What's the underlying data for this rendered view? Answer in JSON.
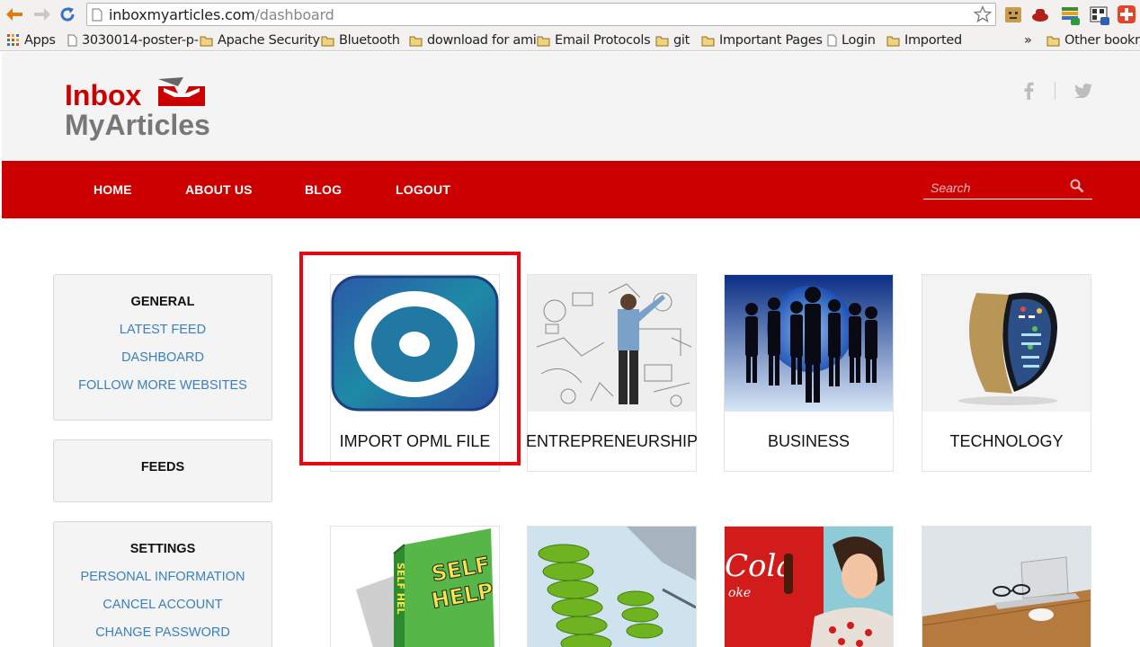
{
  "browser": {
    "url_host": "inboxmyarticles.com",
    "url_path": "/dashboard",
    "bookmarks": [
      {
        "label": "Apps",
        "icon": "apps-grid-icon"
      },
      {
        "label": "3030014-poster-p-",
        "icon": "page-icon"
      },
      {
        "label": "Apache Security",
        "icon": "folder-icon"
      },
      {
        "label": "Bluetooth",
        "icon": "folder-icon"
      },
      {
        "label": "download for ami",
        "icon": "folder-icon"
      },
      {
        "label": "Email Protocols",
        "icon": "folder-icon"
      },
      {
        "label": "git",
        "icon": "folder-icon"
      },
      {
        "label": "Important Pages",
        "icon": "folder-icon"
      },
      {
        "label": "Login",
        "icon": "page-icon"
      },
      {
        "label": "Imported",
        "icon": "folder-icon"
      }
    ],
    "overflow": "»",
    "other_bookmarks": "Other bookm"
  },
  "logo": {
    "line1": "Inbox",
    "line2": "MyArticles"
  },
  "colors": {
    "brand_red": "#cc0000",
    "link_blue": "#3a7fc0",
    "highlight": "#e8070e"
  },
  "nav": {
    "items": [
      "HOME",
      "ABOUT US",
      "BLOG",
      "LOGOUT"
    ],
    "search_placeholder": "Search"
  },
  "sidebar": {
    "general": {
      "title": "GENERAL",
      "links": [
        "LATEST FEED",
        "DASHBOARD",
        "FOLLOW MORE WEBSITES"
      ]
    },
    "feeds": {
      "title": "FEEDS"
    },
    "settings": {
      "title": "SETTINGS",
      "links": [
        "PERSONAL INFORMATION",
        "CANCEL ACCOUNT",
        "CHANGE PASSWORD"
      ]
    }
  },
  "tiles": [
    {
      "label": "IMPORT OPML FILE"
    },
    {
      "label": "ENTREPRENEURSHIP"
    },
    {
      "label": "BUSINESS"
    },
    {
      "label": "TECHNOLOGY"
    },
    {
      "label": "SELF HELP"
    },
    {
      "label": ""
    },
    {
      "label": ""
    },
    {
      "label": ""
    }
  ],
  "image_text": {
    "book_title_line1": "SELF",
    "book_title_line2": "HELP",
    "book_spine": "SELF HEL",
    "ad_brand": "Cola",
    "ad_sub": "oke"
  }
}
